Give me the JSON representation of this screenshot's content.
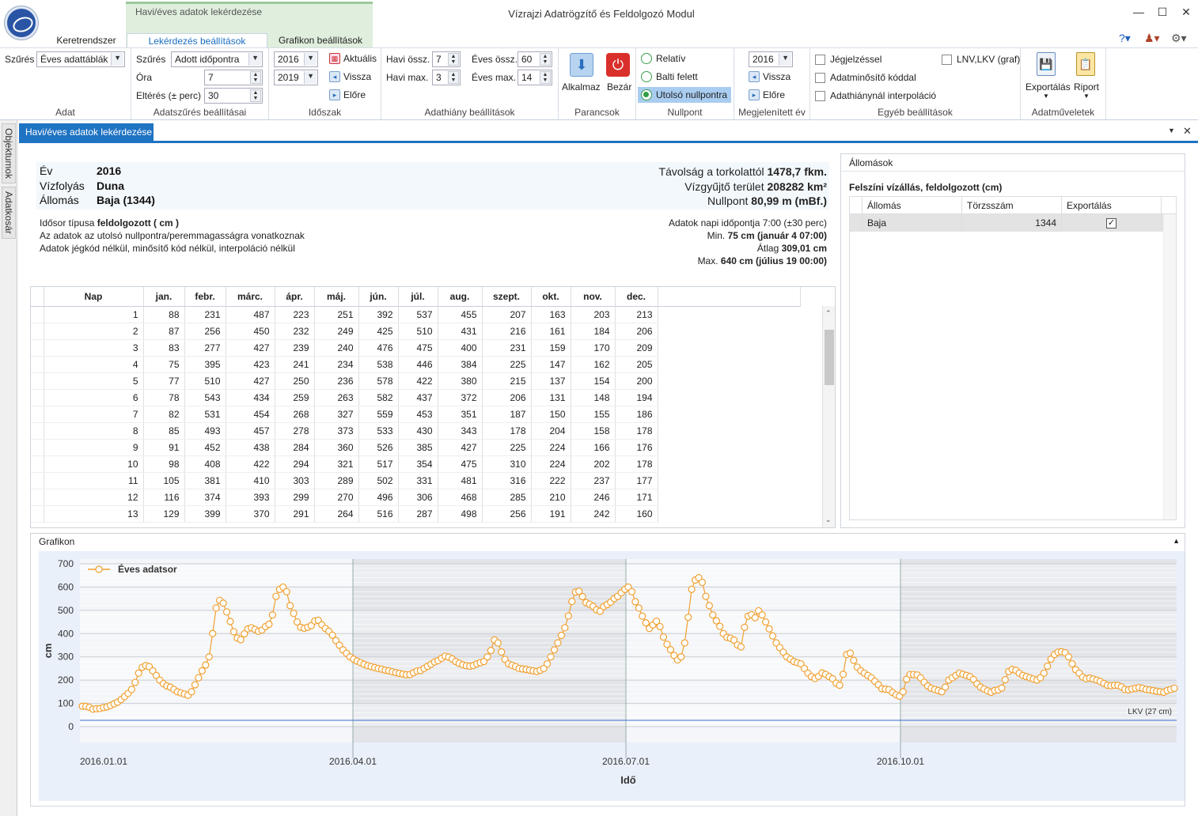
{
  "app": {
    "title": "Vízrajzi Adatrögzítő és Feldolgozó Modul",
    "context_group": "Havi/éves adatok lekérdezése",
    "minimize": "—",
    "maximize": "☐",
    "close": "✕"
  },
  "tabs": {
    "keretrendszer": "Keretrendszer",
    "lekerdezes": "Lekérdezés beállítások",
    "grafikon": "Grafikon beállítások"
  },
  "ribbon": {
    "adat": {
      "label": "Szűrés",
      "value": "Éves adattáblák",
      "group": "Adat"
    },
    "szures": {
      "label": "Szűrés",
      "value": "Adott időpontra",
      "ora_label": "Óra",
      "ora": "7",
      "elteres_label": "Eltérés (± perc)",
      "elteres": "30",
      "group": "Adatszűrés beállításai"
    },
    "idoszak": {
      "from": "2016",
      "to": "2019",
      "aktualis": "Aktuális",
      "vissza": "Vissza",
      "elore": "Előre",
      "group": "Időszak"
    },
    "adathiany": {
      "havi_ossz_label": "Havi össz.",
      "havi_ossz": "7",
      "havi_max_label": "Havi max.",
      "havi_max": "3",
      "eves_ossz_label": "Éves össz.",
      "eves_ossz": "60",
      "eves_max_label": "Éves max.",
      "eves_max": "14",
      "group": "Adathiány beállítások"
    },
    "parancsok": {
      "alkalmaz": "Alkalmaz",
      "bezar": "Bezár",
      "group": "Parancsok"
    },
    "nullpont": {
      "relativ": "Relatív",
      "balti": "Balti felett",
      "utolso": "Utolsó nullpontra",
      "group": "Nullpont"
    },
    "megjelenitett": {
      "value": "2016",
      "vissza": "Vissza",
      "elore": "Előre",
      "group": "Megjelenített év"
    },
    "egyeb": {
      "jegjelzes": "Jégjelzéssel",
      "adatminosito": "Adatminősítő kóddal",
      "interpolacio": "Adathiánynál interpoláció",
      "lnv": "LNV,LKV (graf)",
      "group": "Egyéb beállítások"
    },
    "adatmuveletek": {
      "export": "Exportálás",
      "riport": "Riport",
      "group": "Adatműveletek"
    }
  },
  "side": {
    "objektumok": "Objektumok",
    "adatkosar": "Adatkosár"
  },
  "doc": {
    "tab": "Havi/éves adatok lekérdezése"
  },
  "info": {
    "ev_label": "Év",
    "ev": "2016",
    "vizfolyas_label": "Vízfolyás",
    "vizfolyas": "Duna",
    "allomas_label": "Állomás",
    "allomas": "Baja (1344)",
    "tavolsag_label": "Távolság a torkolattól",
    "tavolsag": "1478,7 fkm.",
    "vizgyujto_label": "Vízgyűjtő terület",
    "vizgyujto": "208282 km²",
    "nullpont_label": "Nullpont",
    "nullpont": "80,99 m (mBf.)",
    "idosor_label": "Idősor típusa",
    "idosor": "feldolgozott  ( cm )",
    "line2": "Az adatok az utolsó nullpontra/peremmagasságra vonatkoznak",
    "line3": "Adatok jégkód nélkül, minősítő kód nélkül, interpoláció nélkül",
    "napi": "Adatok napi időpontja 7:00 (±30 perc)",
    "min_label": "Min.",
    "min": "75 cm (január 4 07:00)",
    "atlag_label": "Átlag",
    "atlag": "309,01 cm",
    "max_label": "Max.",
    "max": "640 cm (július 19 00:00)"
  },
  "table": {
    "headers": [
      "Nap",
      "jan.",
      "febr.",
      "márc.",
      "ápr.",
      "máj.",
      "jún.",
      "júl.",
      "aug.",
      "szept.",
      "okt.",
      "nov.",
      "dec."
    ],
    "rows": [
      [
        "1",
        "88",
        "231",
        "487",
        "223",
        "251",
        "392",
        "537",
        "455",
        "207",
        "163",
        "203",
        "213"
      ],
      [
        "2",
        "87",
        "256",
        "450",
        "232",
        "249",
        "425",
        "510",
        "431",
        "216",
        "161",
        "184",
        "206"
      ],
      [
        "3",
        "83",
        "277",
        "427",
        "239",
        "240",
        "476",
        "475",
        "400",
        "231",
        "159",
        "170",
        "209"
      ],
      [
        "4",
        "75",
        "395",
        "423",
        "241",
        "234",
        "538",
        "446",
        "384",
        "225",
        "147",
        "162",
        "205"
      ],
      [
        "5",
        "77",
        "510",
        "427",
        "250",
        "236",
        "578",
        "422",
        "380",
        "215",
        "137",
        "154",
        "200"
      ],
      [
        "6",
        "78",
        "543",
        "434",
        "259",
        "263",
        "582",
        "437",
        "372",
        "206",
        "131",
        "148",
        "194"
      ],
      [
        "7",
        "82",
        "531",
        "454",
        "268",
        "327",
        "559",
        "453",
        "351",
        "187",
        "150",
        "155",
        "186"
      ],
      [
        "8",
        "85",
        "493",
        "457",
        "278",
        "373",
        "533",
        "430",
        "343",
        "178",
        "204",
        "158",
        "178"
      ],
      [
        "9",
        "91",
        "452",
        "438",
        "284",
        "360",
        "526",
        "385",
        "427",
        "225",
        "224",
        "166",
        "176"
      ],
      [
        "10",
        "98",
        "408",
        "422",
        "294",
        "321",
        "517",
        "354",
        "475",
        "310",
        "224",
        "202",
        "178"
      ],
      [
        "11",
        "105",
        "381",
        "410",
        "303",
        "289",
        "502",
        "331",
        "481",
        "316",
        "222",
        "237",
        "177"
      ],
      [
        "12",
        "116",
        "374",
        "393",
        "299",
        "270",
        "496",
        "306",
        "468",
        "285",
        "210",
        "246",
        "171"
      ],
      [
        "13",
        "129",
        "399",
        "370",
        "291",
        "264",
        "516",
        "287",
        "498",
        "256",
        "191",
        "242",
        "160"
      ]
    ]
  },
  "stations": {
    "title": "Állomások",
    "subtitle": "Felszíni vízállás, feldolgozott (cm)",
    "headers": [
      "Állomás",
      "Törzsszám",
      "Exportálás"
    ],
    "row": {
      "name": "Baja",
      "code": "1344",
      "export": true
    }
  },
  "chart_panel": {
    "title": "Grafikon"
  },
  "chart_data": {
    "type": "line",
    "xlabel": "Idő",
    "ylabel": "cm",
    "ylim": [
      0,
      700
    ],
    "yticks": [
      0,
      100,
      200,
      300,
      400,
      500,
      600,
      700
    ],
    "xticks": [
      "2016.01.01",
      "2016.04.01",
      "2016.07.01",
      "2016.10.01"
    ],
    "legend": "top-left",
    "grid": true,
    "series": [
      {
        "name": "Éves adatsor",
        "color": "#f0a030",
        "values": [
          88,
          87,
          83,
          75,
          77,
          78,
          82,
          85,
          91,
          98,
          105,
          116,
          129,
          143,
          160,
          190,
          230,
          255,
          262,
          258,
          240,
          220,
          200,
          185,
          175,
          170,
          160,
          150,
          145,
          140,
          135,
          150,
          180,
          210,
          240,
          265,
          300,
          400,
          510,
          543,
          531,
          493,
          452,
          408,
          381,
          374,
          399,
          420,
          425,
          418,
          410,
          415,
          430,
          440,
          480,
          560,
          590,
          600,
          580,
          520,
          487,
          450,
          427,
          423,
          427,
          434,
          454,
          457,
          438,
          422,
          410,
          393,
          370,
          350,
          330,
          315,
          300,
          290,
          282,
          275,
          268,
          262,
          258,
          254,
          250,
          247,
          243,
          240,
          236,
          232,
          229,
          226,
          223,
          224,
          232,
          239,
          241,
          250,
          259,
          268,
          278,
          284,
          294,
          303,
          299,
          291,
          280,
          272,
          266,
          262,
          260,
          263,
          270,
          275,
          280,
          300,
          327,
          373,
          360,
          321,
          289,
          270,
          264,
          258,
          250,
          248,
          246,
          243,
          240,
          237,
          242,
          250,
          270,
          300,
          330,
          360,
          392,
          425,
          476,
          538,
          578,
          582,
          559,
          533,
          526,
          517,
          502,
          496,
          516,
          525,
          535,
          550,
          560,
          575,
          590,
          600,
          580,
          537,
          510,
          475,
          446,
          422,
          437,
          453,
          430,
          385,
          354,
          331,
          306,
          287,
          300,
          360,
          470,
          590,
          630,
          640,
          620,
          560,
          520,
          480,
          455,
          431,
          400,
          384,
          380,
          372,
          351,
          343,
          427,
          475,
          481,
          468,
          498,
          480,
          450,
          420,
          390,
          360,
          340,
          320,
          300,
          290,
          280,
          275,
          270,
          250,
          230,
          215,
          207,
          216,
          231,
          225,
          215,
          206,
          187,
          178,
          225,
          310,
          316,
          285,
          256,
          240,
          230,
          220,
          210,
          195,
          180,
          163,
          161,
          159,
          147,
          137,
          131,
          150,
          204,
          224,
          224,
          222,
          210,
          191,
          175,
          165,
          160,
          155,
          150,
          170,
          200,
          210,
          220,
          230,
          225,
          220,
          215,
          203,
          184,
          170,
          162,
          154,
          148,
          155,
          158,
          166,
          202,
          237,
          246,
          242,
          230,
          220,
          215,
          210,
          205,
          200,
          210,
          230,
          260,
          290,
          310,
          320,
          322,
          318,
          300,
          270,
          245,
          230,
          213,
          206,
          209,
          205,
          200,
          194,
          186,
          178,
          176,
          178,
          177,
          171,
          160,
          158,
          162,
          165,
          168,
          165,
          160,
          158,
          155,
          152,
          150,
          148,
          155,
          160,
          165
        ]
      }
    ],
    "annotation": "LKV (27 cm)",
    "lkv": 27
  }
}
